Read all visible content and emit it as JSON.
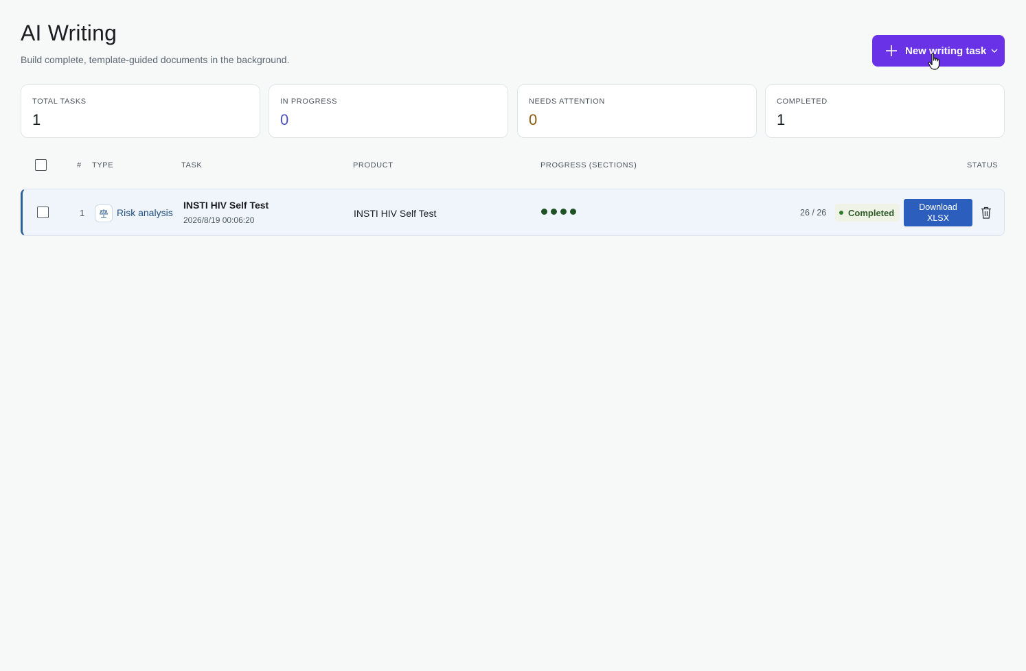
{
  "header": {
    "title": "AI Writing",
    "subtitle": "Build complete, template-guided documents in the background.",
    "new_task_label": "New writing task"
  },
  "stats": [
    {
      "label": "TOTAL TASKS",
      "value": "1",
      "color": "#1b1e21"
    },
    {
      "label": "IN PROGRESS",
      "value": "0",
      "color": "#4a4ec2"
    },
    {
      "label": "NEEDS ATTENTION",
      "value": "0",
      "color": "#8a5a0e"
    },
    {
      "label": "COMPLETED",
      "value": "1",
      "color": "#1b1e21"
    }
  ],
  "table": {
    "columns": {
      "num": "#",
      "type": "TYPE",
      "task": "TASK",
      "product": "PRODUCT",
      "progress": "PROGRESS (SECTIONS)",
      "status": "STATUS"
    },
    "rows": [
      {
        "num": "1",
        "type": "Risk analysis",
        "type_icon": "scales-icon",
        "task_name": "INSTI HIV Self Test",
        "task_date": "2026/8/19 00:06:20",
        "product": "INSTI HIV Self Test",
        "progress_dots": 4,
        "progress_text": "26 / 26",
        "status": "Completed",
        "download_line1": "Download",
        "download_line2": "XLSX"
      }
    ]
  },
  "colors": {
    "accent": "#6a32e6",
    "download": "#2c5fbd",
    "row_accent": "#2e5f96",
    "completed": "#2f7d2b"
  }
}
